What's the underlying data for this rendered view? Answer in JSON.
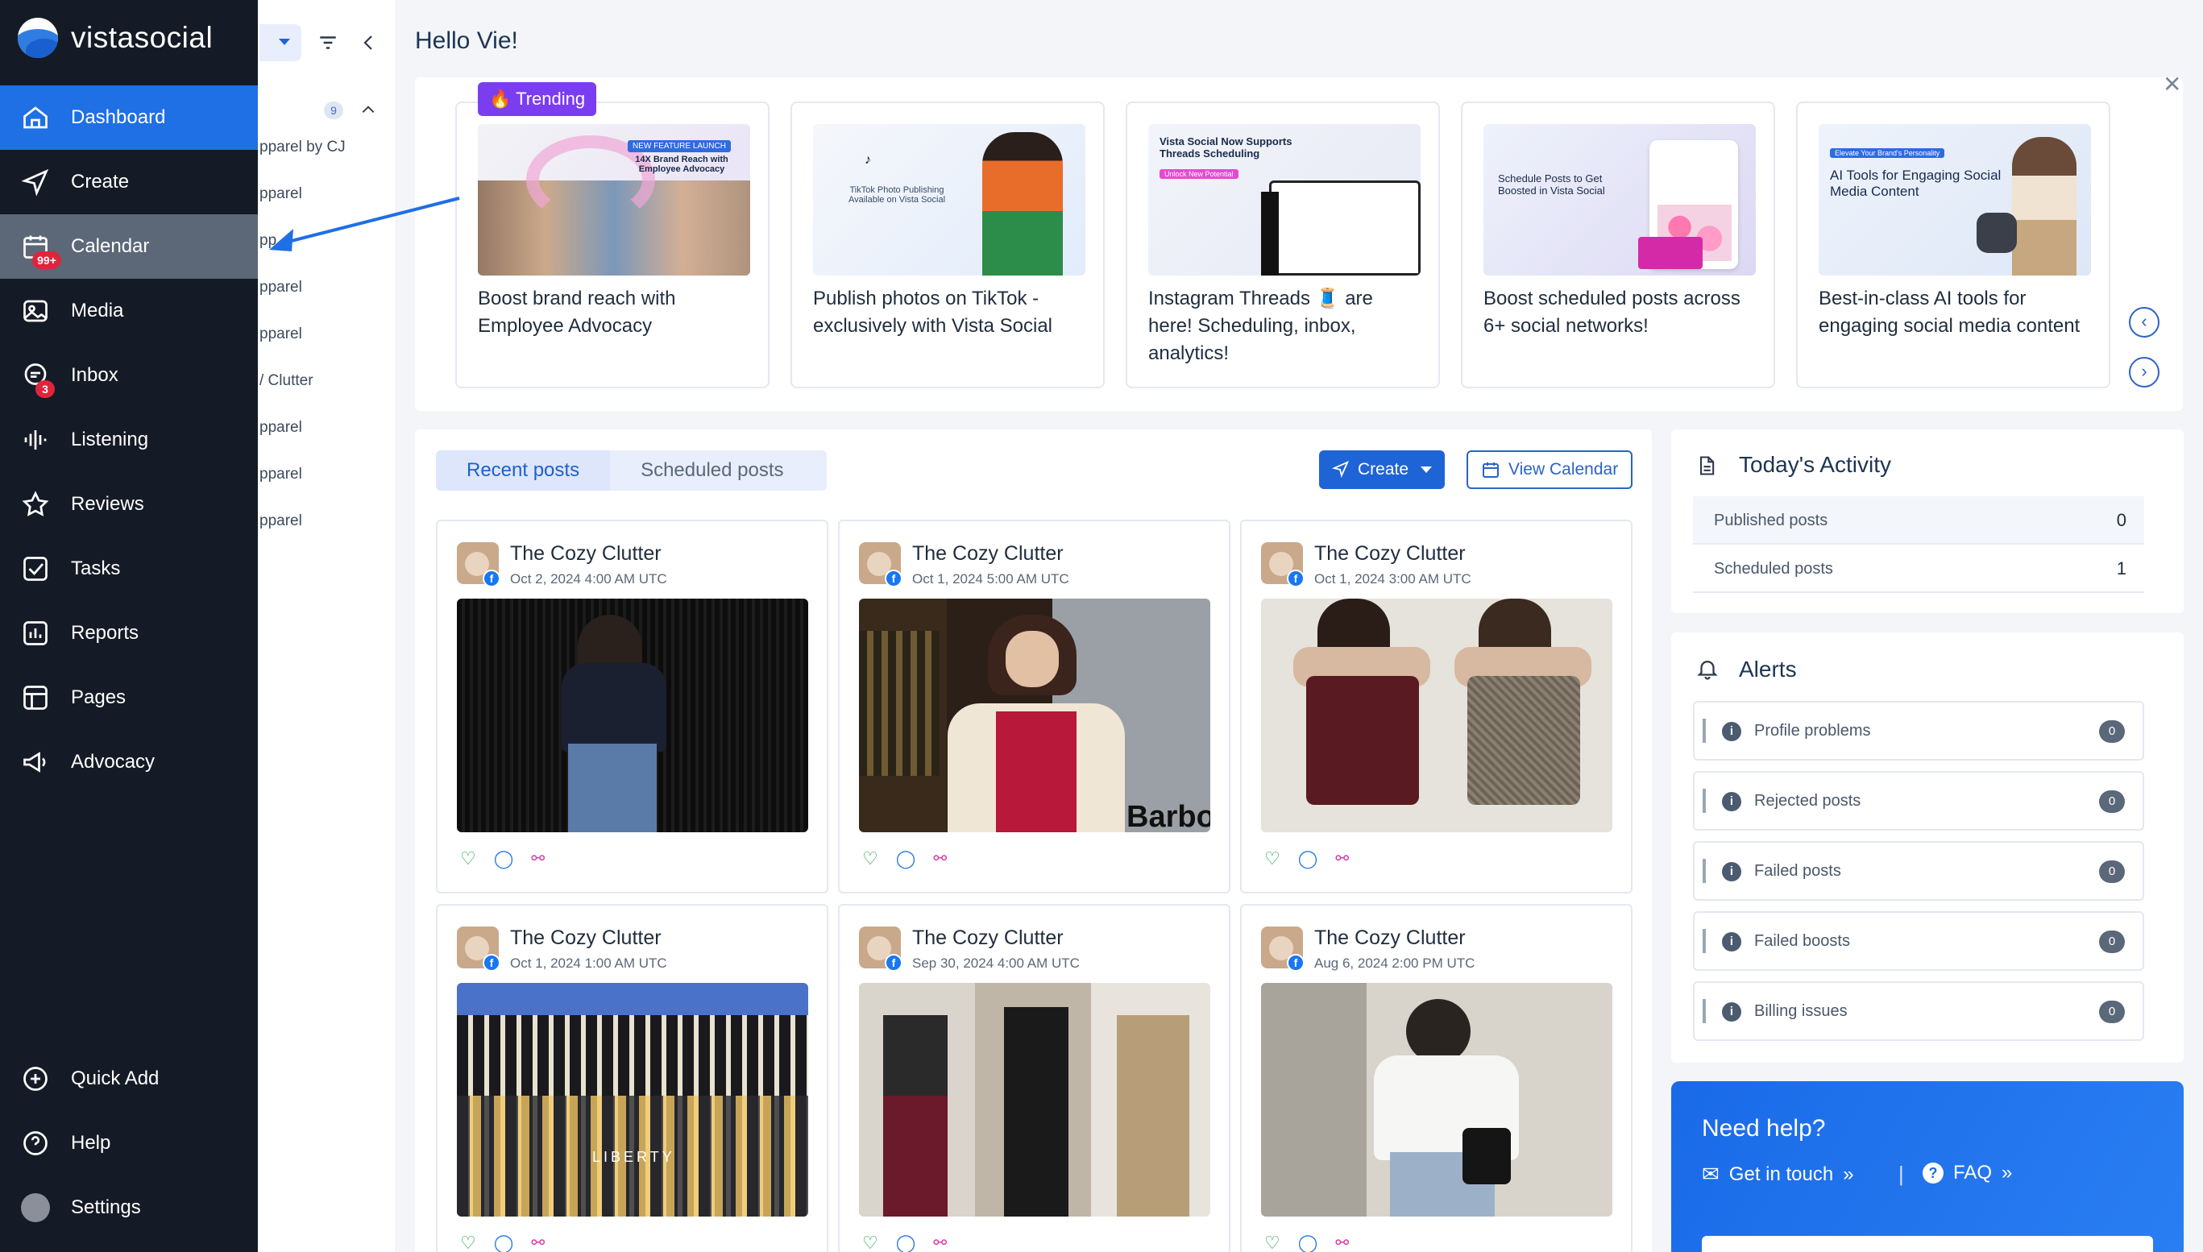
{
  "app": {
    "name": "vistasocial",
    "greeting": "Hello Vie!"
  },
  "nav": {
    "items": [
      {
        "label": "Dashboard"
      },
      {
        "label": "Create"
      },
      {
        "label": "Calendar",
        "badge": "99+"
      },
      {
        "label": "Media"
      },
      {
        "label": "Inbox",
        "badge": "3"
      },
      {
        "label": "Listening"
      },
      {
        "label": "Reviews"
      },
      {
        "label": "Tasks"
      },
      {
        "label": "Reports"
      },
      {
        "label": "Pages"
      },
      {
        "label": "Advocacy"
      }
    ],
    "bottom": [
      {
        "label": "Quick Add"
      },
      {
        "label": "Help"
      },
      {
        "label": "Settings"
      }
    ]
  },
  "subpanel": {
    "count": "9",
    "items": [
      "pparel by CJ",
      "pparel",
      "pp",
      "pparel",
      "pparel",
      "/ Clutter",
      "pparel",
      "pparel",
      "pparel"
    ]
  },
  "trending": {
    "tag": "Trending",
    "cards": [
      {
        "text": "Boost brand reach with Employee Advocacy",
        "thumb_title": "14X Brand Reach with Employee Advocacy",
        "thumb_tag": "NEW FEATURE LAUNCH"
      },
      {
        "text": "Publish photos on TikTok - exclusively with Vista Social",
        "thumb_title": "TikTok Photo Publishing Available on Vista Social"
      },
      {
        "text": "Instagram Threads 🧵 are here! Scheduling, inbox, analytics!",
        "thumb_title": "Vista Social Now Supports Threads Scheduling",
        "thumb_tag": "Unlock New Potential"
      },
      {
        "text": "Boost scheduled posts across 6+ social networks!",
        "thumb_title": "Schedule Posts to Get Boosted in Vista Social"
      },
      {
        "text": "Best-in-class AI tools for engaging social media content",
        "thumb_title": "AI Tools for Engaging Social Media Content",
        "thumb_tag": "Elevate Your Brand's Personality"
      }
    ]
  },
  "posts": {
    "tabs": [
      "Recent posts",
      "Scheduled posts"
    ],
    "create_label": "Create",
    "view_calendar_label": "View Calendar",
    "items": [
      {
        "name": "The Cozy Clutter",
        "date": "Oct 2, 2024 4:00 AM UTC"
      },
      {
        "name": "The Cozy Clutter",
        "date": "Oct 1, 2024 5:00 AM UTC"
      },
      {
        "name": "The Cozy Clutter",
        "date": "Oct 1, 2024 3:00 AM UTC"
      },
      {
        "name": "The Cozy Clutter",
        "date": "Oct 1, 2024 1:00 AM UTC"
      },
      {
        "name": "The Cozy Clutter",
        "date": "Sep 30, 2024 4:00 AM UTC"
      },
      {
        "name": "The Cozy Clutter",
        "date": "Aug 6, 2024 2:00 PM UTC"
      }
    ],
    "image_texts": [
      "Barbo",
      "LIBERTY"
    ]
  },
  "activity": {
    "title": "Today's Activity",
    "rows": [
      {
        "label": "Published posts",
        "value": "0"
      },
      {
        "label": "Scheduled posts",
        "value": "1"
      }
    ]
  },
  "alerts": {
    "title": "Alerts",
    "rows": [
      {
        "label": "Profile problems",
        "count": "0"
      },
      {
        "label": "Rejected posts",
        "count": "0"
      },
      {
        "label": "Failed posts",
        "count": "0"
      },
      {
        "label": "Failed boosts",
        "count": "0"
      },
      {
        "label": "Billing issues",
        "count": "0"
      }
    ]
  },
  "help": {
    "title": "Need help?",
    "get_in_touch": "Get in touch",
    "faq": "FAQ"
  },
  "colors": {
    "sidebar": "#151b26",
    "active": "#1f6fe5",
    "accent": "#1f64d6",
    "badge": "#e0243b",
    "trending": "#7b3df0"
  }
}
